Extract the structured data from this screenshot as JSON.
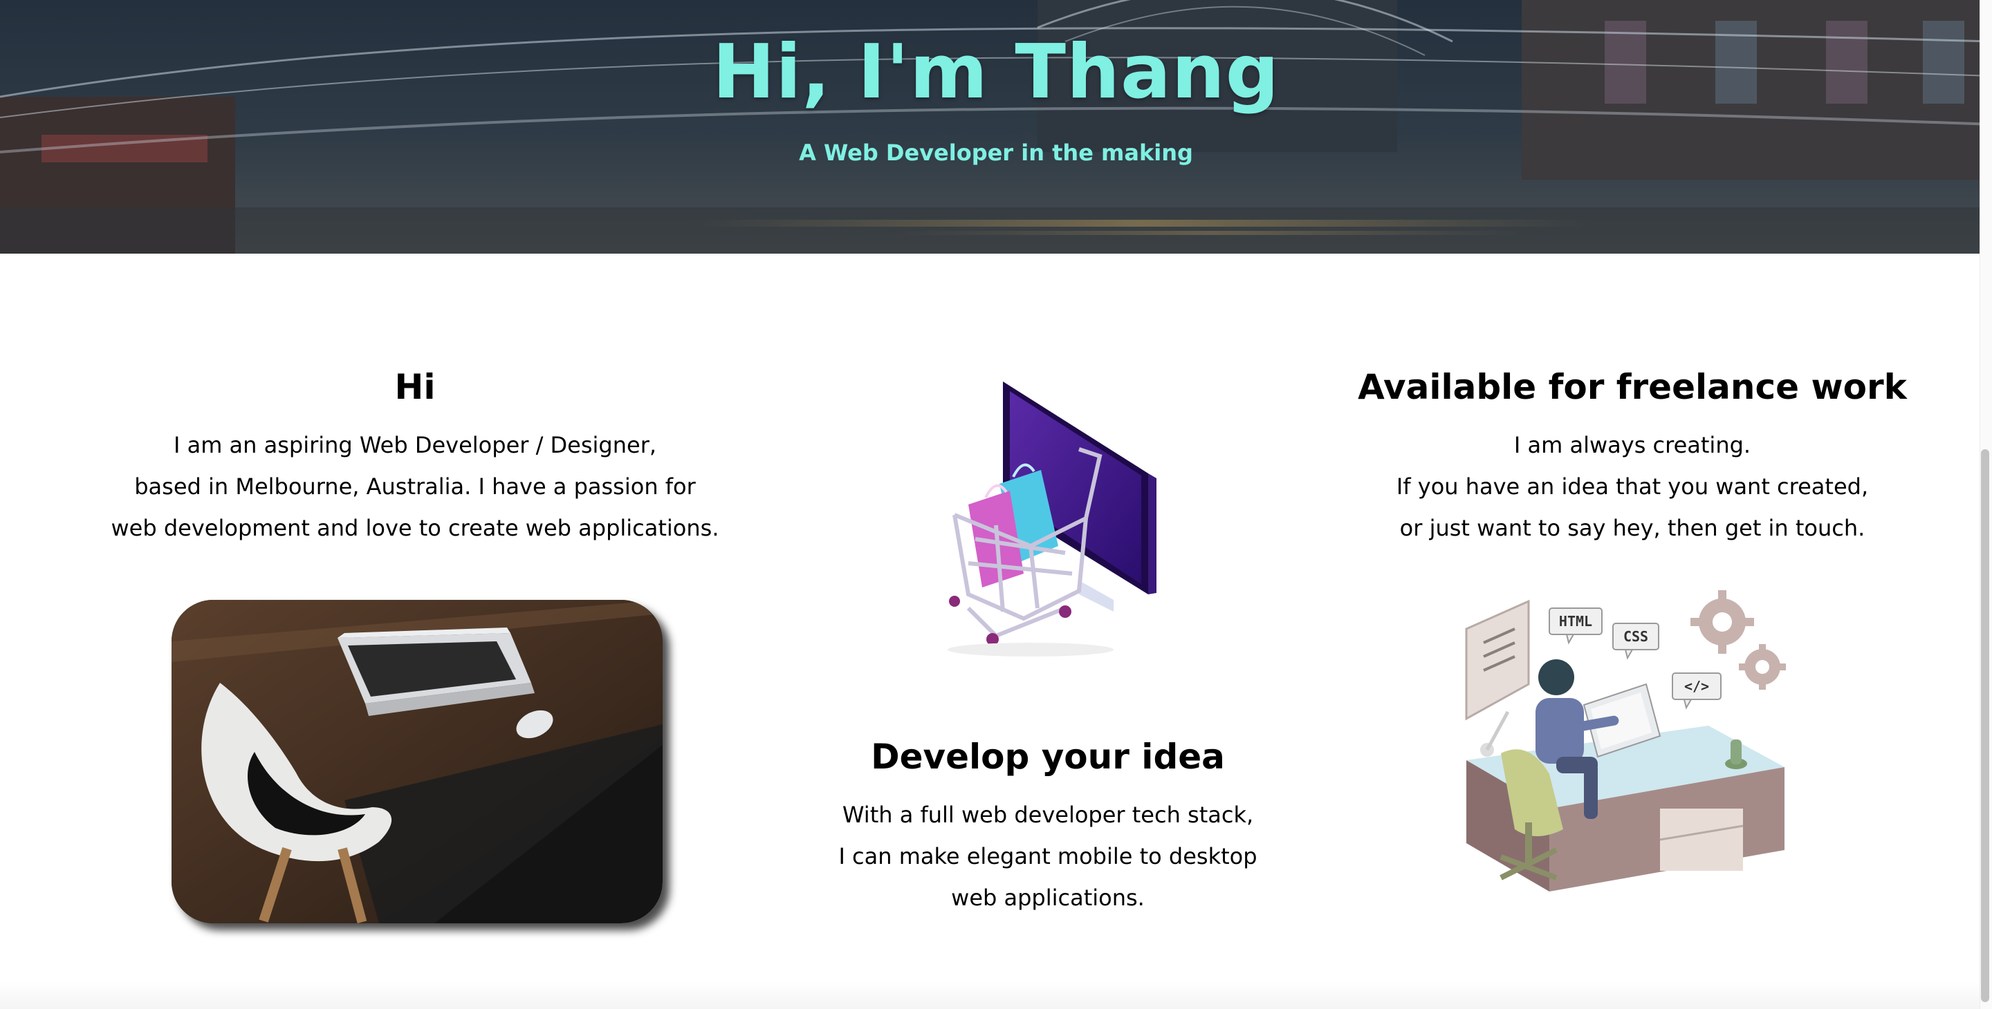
{
  "hero": {
    "title": "Hi, I'm Thang",
    "subtitle": "A Web Developer in the making",
    "accent_color": "#7ff0e2"
  },
  "intro": {
    "heading": "Hi",
    "lines": [
      "I am an aspiring Web Developer / Designer,",
      "based in Melbourne, Australia. I have a passion for",
      "web development and love to create web applications."
    ],
    "image_icon": "desk-laptop-chair-photo"
  },
  "develop": {
    "heading": "Develop your idea",
    "lines": [
      "With a full web developer tech stack,",
      "I can make elegant mobile to desktop",
      "web applications."
    ],
    "image_icon": "shopping-cart-monitor-illustration"
  },
  "freelance": {
    "heading": "Available for freelance work",
    "lines": [
      "I am always creating.",
      "If you have an idea that you want created,",
      "or just want to say hey, then get in touch."
    ],
    "image_icon": "developer-at-desk-illustration",
    "bubbles": [
      "HTML",
      "CSS",
      "</>"
    ]
  }
}
